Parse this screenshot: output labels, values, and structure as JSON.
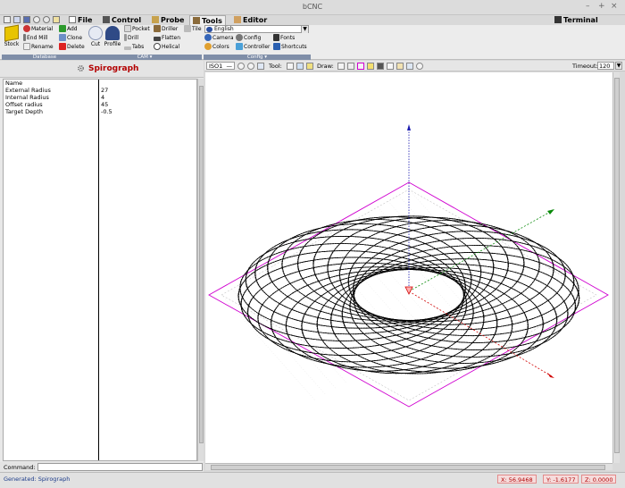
{
  "window": {
    "title": "bCNC"
  },
  "menu": {
    "tabs": [
      "File",
      "Control",
      "Probe",
      "Tools",
      "Editor"
    ],
    "active": "Tools",
    "terminal": "Terminal"
  },
  "ribbon": {
    "database": {
      "label": "Database",
      "stock": "Stock",
      "material": "Material",
      "end_mill": "End Mill",
      "rename": "Rename",
      "add": "Add",
      "clone": "Clone",
      "delete": "Delete"
    },
    "cam": {
      "label": "CAM",
      "cut": "Cut",
      "profile": "Profile",
      "pocket": "Pocket",
      "drill": "Drill",
      "tabs": "Tabs",
      "driller": "Driller",
      "flatten": "Flatten",
      "helical": "Helical",
      "tile": "Tile"
    },
    "config": {
      "label": "Config",
      "language": "English",
      "camera": "Camera",
      "config": "Config",
      "fonts": "Fonts",
      "colors": "Colors",
      "controller": "Controller",
      "shortcuts": "Shortcuts"
    }
  },
  "panel": {
    "title": "Spirograph",
    "params": [
      {
        "name": "Name",
        "value": ""
      },
      {
        "name": "External Radius",
        "value": "27"
      },
      {
        "name": "Internal Radius",
        "value": "4"
      },
      {
        "name": "Offset radius",
        "value": "45"
      },
      {
        "name": "Target Depth",
        "value": "-0.5"
      }
    ]
  },
  "command": {
    "label": "Command:",
    "value": ""
  },
  "canvas_toolbar": {
    "view": "ISO1",
    "tool_label": "Tool:",
    "draw_label": "Draw:",
    "timeout_label": "Timeout:",
    "timeout_value": "120"
  },
  "status": {
    "message": "Generated: Spirograph",
    "x": "X: 56.9468",
    "y": "Y: -1.6177",
    "z": "Z: 0.0000"
  },
  "colors": {
    "panel_title": "#b30000",
    "status_text": "#1d3c8a",
    "coord_text": "#b00000",
    "margin": "#d000d0",
    "z_axis": "#1a1ab0",
    "y_axis": "#0a8a0a",
    "x_axis": "#d00000"
  }
}
